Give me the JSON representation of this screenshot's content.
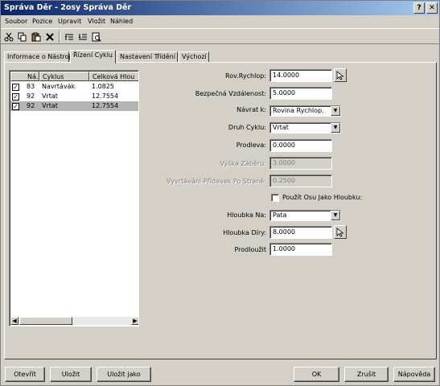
{
  "window": {
    "title": "Správa Děr - 2osy Správa Děr",
    "help_label": "?",
    "close_label": "✕"
  },
  "menu": [
    "Soubor",
    "Pozice",
    "Upravit",
    "Vložit",
    "Náhled"
  ],
  "toolbar": {
    "icons": [
      "scissors-icon",
      "copy-icon",
      "paste-icon",
      "delete-icon",
      "move-up-icon",
      "move-down-icon",
      "preview-icon"
    ]
  },
  "tabs": [
    "Informace o Nástroji",
    "Řízení Cyklu",
    "Nastavení Třídění",
    "Výchozí"
  ],
  "active_tab": 1,
  "list": {
    "headers": [
      "Ná...",
      "Cyklus",
      "Celková Hlou"
    ],
    "rows": [
      {
        "checked": true,
        "num": "83",
        "cycle": "Navrtávák",
        "depth": "1.0825",
        "selected": false
      },
      {
        "checked": true,
        "num": "92",
        "cycle": "Vrtat",
        "depth": "12.7554",
        "selected": false
      },
      {
        "checked": true,
        "num": "92",
        "cycle": "Vrtat",
        "depth": "12.7554",
        "selected": true
      }
    ]
  },
  "form": {
    "rov_label": "Rov.Rychlop:",
    "rov_value": "14.0000",
    "bez_label": "Bezpečná Vzdálenost:",
    "bez_value": "5.0000",
    "navrat_label": "Návrat k:",
    "navrat_value": "Rovina Rychlop.",
    "druh_label": "Druh Cyklu:",
    "druh_value": "Vrtat",
    "prodleva_label": "Prodleva:",
    "prodleva_value": "0.0000",
    "vyska_label": "Výška Záběru:",
    "vyska_value": "3.0000",
    "vyvrt_label": "Vyvrtávání-Přídavek Po Straně:",
    "vyvrt_value": "0.2500",
    "osa_label": "Použít Osu Jako Hloubku:",
    "hloubka_na_label": "Hloubka Na:",
    "hloubka_na_value": "Pata",
    "hloubka_diry_label": "Hloubka Díry:",
    "hloubka_diry_value": "8.0000",
    "prodlouzit_label": "Prodloužit",
    "prodlouzit_value": "1.0000"
  },
  "buttons": {
    "open": "Otevřít",
    "save": "Uložit",
    "save_as": "Uložit jako",
    "ok": "OK",
    "cancel": "Zrušit",
    "help": "Nápověda"
  }
}
